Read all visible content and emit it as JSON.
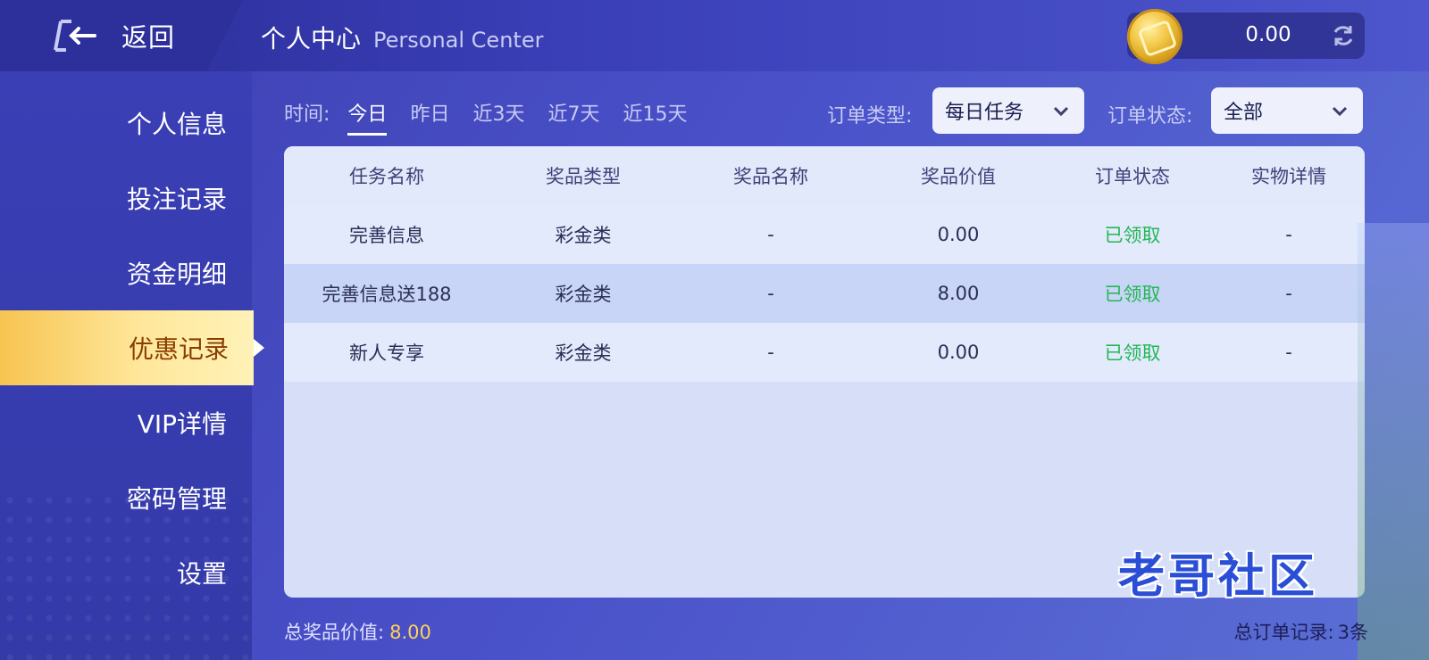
{
  "header": {
    "back_label": "返回",
    "title_cn": "个人中心",
    "title_en": "Personal Center",
    "balance": "0.00"
  },
  "sidebar": {
    "items": [
      {
        "label": "个人信息"
      },
      {
        "label": "投注记录"
      },
      {
        "label": "资金明细"
      },
      {
        "label": "优惠记录"
      },
      {
        "label": "VIP详情"
      },
      {
        "label": "密码管理"
      },
      {
        "label": "设置"
      }
    ],
    "active_index": 3
  },
  "filters": {
    "time_label": "时间:",
    "time_tabs": [
      "今日",
      "昨日",
      "近3天",
      "近7天",
      "近15天"
    ],
    "order_type_label": "订单类型:",
    "order_type_value": "每日任务",
    "order_status_label": "订单状态:",
    "order_status_value": "全部"
  },
  "table": {
    "columns": [
      "任务名称",
      "奖品类型",
      "奖品名称",
      "奖品价值",
      "订单状态",
      "实物详情"
    ],
    "rows": [
      [
        "完善信息",
        "彩金类",
        "-",
        "0.00",
        "已领取",
        "-"
      ],
      [
        "完善信息送188",
        "彩金类",
        "-",
        "8.00",
        "已领取",
        "-"
      ],
      [
        "新人专享",
        "彩金类",
        "-",
        "0.00",
        "已领取",
        "-"
      ]
    ]
  },
  "footer": {
    "total_value_label": "总奖品价值:",
    "total_value": "8.00",
    "total_records_label": "总订单记录:",
    "total_records": "3条"
  },
  "watermark": "老哥社区",
  "colors": {
    "accent_gold": "#ffd15a",
    "status_green": "#22b755",
    "active_tab_bg": "#f7c451"
  }
}
